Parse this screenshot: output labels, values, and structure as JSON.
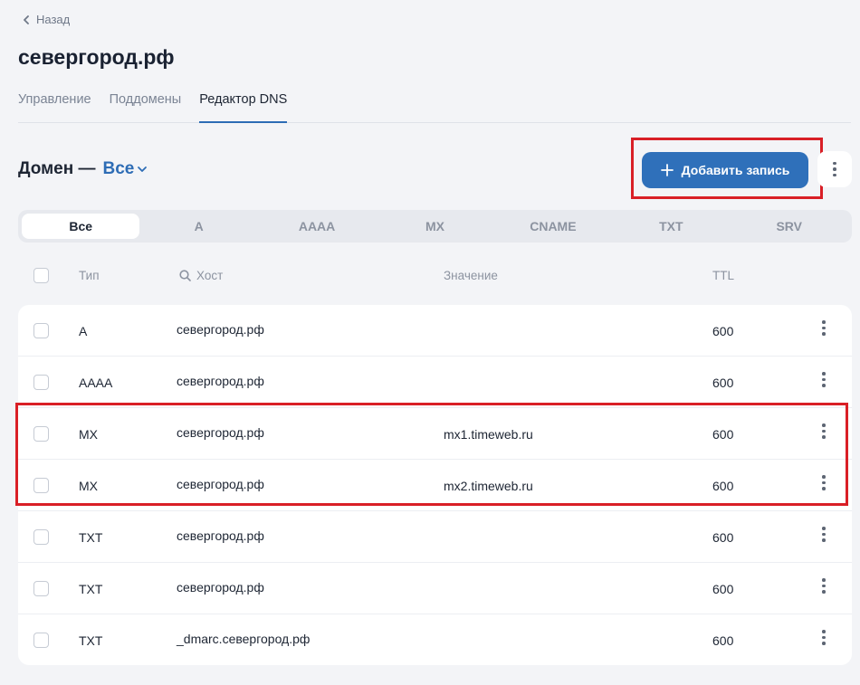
{
  "nav": {
    "back_label": "Назад"
  },
  "page": {
    "title": "севергород.рф"
  },
  "tabs": [
    {
      "label": "Управление",
      "active": false
    },
    {
      "label": "Поддомены",
      "active": false
    },
    {
      "label": "Редактор DNS",
      "active": true
    }
  ],
  "domain_filter": {
    "label": "Домен —",
    "value": "Все"
  },
  "toolbar": {
    "add_label": "Добавить запись"
  },
  "type_tabs": [
    "Все",
    "A",
    "AAAA",
    "MX",
    "CNAME",
    "TXT",
    "SRV"
  ],
  "table": {
    "headers": {
      "type": "Тип",
      "host": "Хост",
      "value": "Значение",
      "ttl": "TTL"
    },
    "rows": [
      {
        "type": "A",
        "host": "севергород.рф",
        "value": "",
        "ttl": "600"
      },
      {
        "type": "AAAA",
        "host": "севергород.рф",
        "value": "",
        "ttl": "600"
      },
      {
        "type": "MX",
        "host": "севергород.рф",
        "value": "mx1.timeweb.ru",
        "ttl": "600"
      },
      {
        "type": "MX",
        "host": "севергород.рф",
        "value": "mx2.timeweb.ru",
        "ttl": "600"
      },
      {
        "type": "TXT",
        "host": "севергород.рф",
        "value": "",
        "ttl": "600"
      },
      {
        "type": "TXT",
        "host": "севергород.рф",
        "value": "",
        "ttl": "600"
      },
      {
        "type": "TXT",
        "host": "_dmarc.севергород.рф",
        "value": "",
        "ttl": "600"
      }
    ]
  },
  "colors": {
    "accent": "#2f70ba",
    "highlight": "#d91f26",
    "background": "#f3f4f7"
  },
  "icons": {
    "back": "chevron-left-icon",
    "filter": "chevron-down-icon",
    "add": "plus-icon",
    "more": "kebab-icon",
    "search": "search-icon"
  }
}
